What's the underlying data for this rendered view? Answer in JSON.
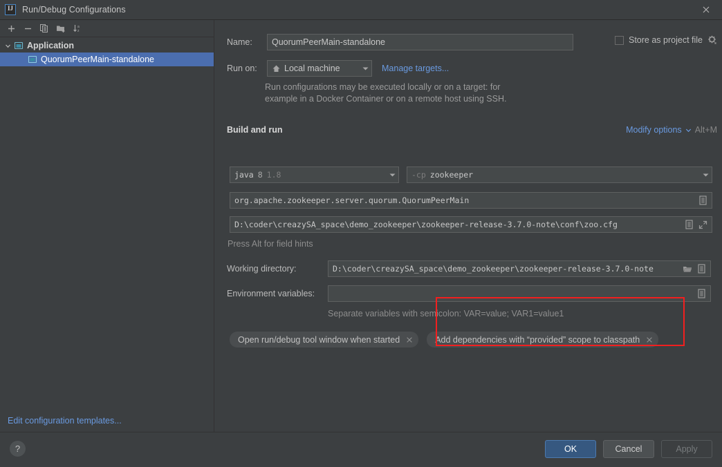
{
  "window": {
    "title": "Run/Debug Configurations",
    "logo_icon": "intellij-idea-logo-icon",
    "close_icon": "close-icon"
  },
  "sidebar": {
    "toolbar": [
      {
        "name": "add-configuration-button",
        "icon": "plus-icon",
        "label": "+"
      },
      {
        "name": "remove-configuration-button",
        "icon": "minus-icon",
        "label": "−"
      },
      {
        "name": "copy-configuration-button",
        "icon": "copy-icon",
        "label": ""
      },
      {
        "name": "move-to-folder-button",
        "icon": "new-folder-icon",
        "label": ""
      },
      {
        "name": "sort-configurations-button",
        "icon": "sort-alphabetically-icon",
        "label": ""
      }
    ],
    "tree": {
      "group_label": "Application",
      "group_icon": "application-icon",
      "chevron_icon": "chevron-down-icon",
      "items": [
        {
          "label": "QuorumPeerMain-standalone",
          "icon": "application-icon",
          "selected": true
        }
      ]
    },
    "edit_templates_link": "Edit configuration templates..."
  },
  "form": {
    "name_label": "Name:",
    "name_value": "QuorumPeerMain-standalone",
    "store_as_project_file_label": "Store as project file",
    "store_as_project_file_checked": false,
    "store_gear_icon": "gear-icon",
    "run_on_label": "Run on:",
    "run_on_value": "Local machine",
    "run_on_icon": "home-icon",
    "manage_targets_link": "Manage targets...",
    "target_hint_line1": "Run configurations may be executed locally or on a target: for",
    "target_hint_line2": "example in a Docker Container or on a remote host using SSH.",
    "section_title": "Build and run",
    "modify_options_link": "Modify options",
    "modify_options_chevron_icon": "chevron-down-icon",
    "modify_options_shortcut": "Alt+M",
    "jre_name": "java",
    "jre_version_short": "8",
    "jre_version_full": "1.8",
    "classpath_flag": "-cp",
    "classpath_module": "zookeeper",
    "main_class_value": "org.apache.zookeeper.server.quorum.QuorumPeerMain",
    "main_class_expand_icon": "editor-popup-icon",
    "program_arguments_value": "D:\\coder\\creazySA_space\\demo_zookeeper\\zookeeper-release-3.7.0-note\\conf\\zoo.cfg",
    "program_arguments_popup_icon": "editor-popup-icon",
    "program_arguments_expand_icon": "expand-icon",
    "alt_hint": "Press Alt for field hints",
    "working_directory_label": "Working directory:",
    "working_directory_value": "D:\\coder\\creazySA_space\\demo_zookeeper\\zookeeper-release-3.7.0-note",
    "working_directory_browse_icon": "folder-icon",
    "working_directory_popup_icon": "editor-popup-icon",
    "environment_variables_label": "Environment variables:",
    "environment_variables_value": "",
    "environment_variables_popup_icon": "editor-popup-icon",
    "environment_variables_hint": "Separate variables with semicolon: VAR=value; VAR1=value1",
    "chips": [
      {
        "label": "Open run/debug tool window when started",
        "close_icon": "close-icon",
        "highlighted": false
      },
      {
        "label": "Add dependencies with “provided” scope to classpath",
        "close_icon": "close-icon",
        "highlighted": true
      }
    ],
    "highlight_color": "#f21f1f"
  },
  "footer": {
    "help_label": "?",
    "help_icon": "help-icon",
    "ok_label": "OK",
    "cancel_label": "Cancel",
    "apply_label": "Apply",
    "apply_enabled": false
  },
  "colors": {
    "background": "#3c3f41",
    "field_background": "#45494a",
    "selection": "#4b6eaf",
    "link": "#6a9ae0",
    "primary_button": "#365880",
    "accent_icon": "#4e9ab5"
  }
}
